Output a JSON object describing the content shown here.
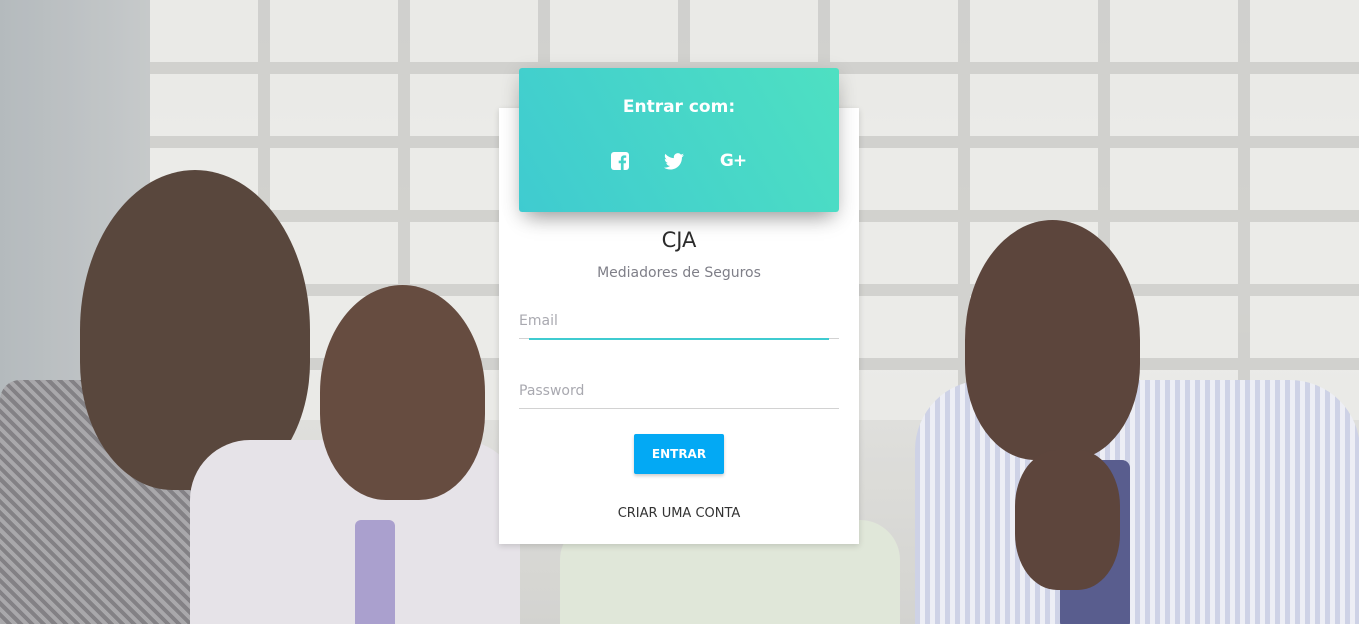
{
  "social_login": {
    "heading": "Entrar com:",
    "buttons": [
      {
        "icon": "facebook-icon"
      },
      {
        "icon": "twitter-icon"
      },
      {
        "icon": "google-plus-icon",
        "glyph": "G+"
      }
    ]
  },
  "brand": {
    "name": "CJA",
    "tagline": "Mediadores de Seguros"
  },
  "form": {
    "email_placeholder": "Email",
    "password_placeholder": "Password",
    "submit_label": "ENTRAR",
    "signup_label": "CRIAR UMA CONTA"
  },
  "colors": {
    "header_gradient_start": "#3fcbd0",
    "header_gradient_end": "#4ee0c2",
    "primary_button": "#03a9f4",
    "input_focus": "#3fcbd0"
  }
}
